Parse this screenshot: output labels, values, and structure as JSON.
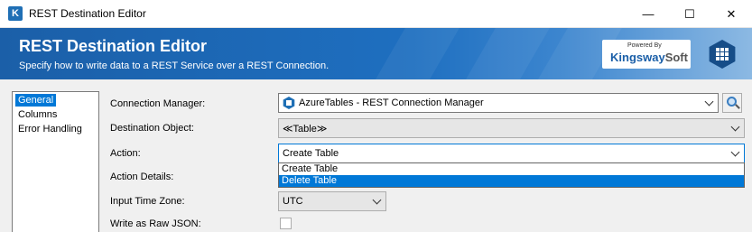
{
  "window": {
    "app_icon_letter": "K",
    "title": "REST Destination Editor",
    "minimize_glyph": "—",
    "maximize_glyph": "☐",
    "close_glyph": "✕"
  },
  "banner": {
    "title": "REST Destination Editor",
    "subtitle": "Specify how to write data to a REST Service over a REST Connection.",
    "brand_powered": "Powered By",
    "brand_k": "K",
    "brand_ingsway": "ingsway",
    "brand_soft": "Soft",
    "accent_color": "#1b5fa8"
  },
  "nav": {
    "items": [
      {
        "label": "General",
        "selected": true
      },
      {
        "label": "Columns",
        "selected": false
      },
      {
        "label": "Error Handling",
        "selected": false
      }
    ]
  },
  "form": {
    "connection_manager_label": "Connection Manager:",
    "connection_manager_value": "AzureTables - REST Connection Manager",
    "destination_object_label": "Destination Object:",
    "destination_object_value": "≪Table≫",
    "action_label": "Action:",
    "action_value": "Create Table",
    "action_options": [
      "Create Table",
      "Delete Table"
    ],
    "action_details_label": "Action Details:",
    "input_time_zone_label": "Input Time Zone:",
    "input_time_zone_value": "UTC",
    "write_raw_json_label": "Write as Raw JSON:",
    "write_raw_json_checked": false
  }
}
